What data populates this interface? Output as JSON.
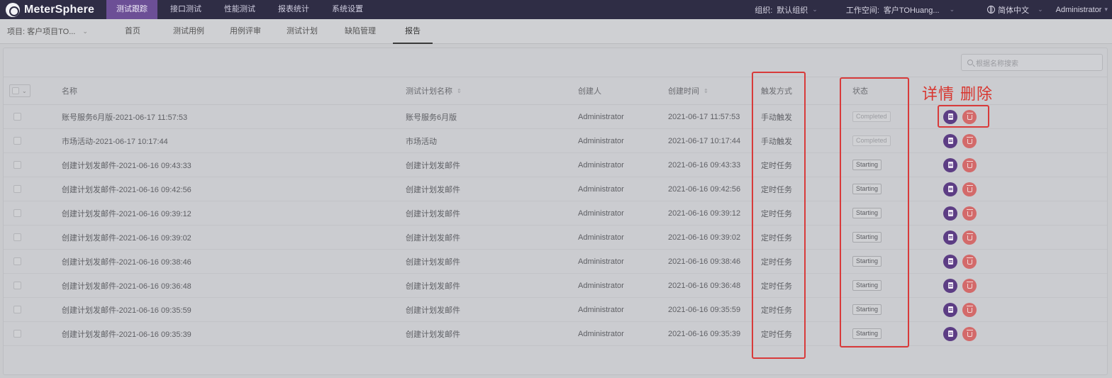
{
  "app": {
    "logo": "MeterSphere"
  },
  "topnav": {
    "items": [
      {
        "label": "测试跟踪"
      },
      {
        "label": "接口测试"
      },
      {
        "label": "性能测试"
      },
      {
        "label": "报表统计"
      },
      {
        "label": "系统设置"
      }
    ]
  },
  "topright": {
    "org_label": "组织:",
    "org_value": "默认组织",
    "workspace_label": "工作空间:",
    "workspace_value": "客户TOHuang...",
    "language": "简体中文",
    "user": "Administrator"
  },
  "subnav": {
    "project_label": "项目: 客户项目TO...",
    "items": [
      {
        "label": "首页"
      },
      {
        "label": "测试用例"
      },
      {
        "label": "用例评审"
      },
      {
        "label": "测试计划"
      },
      {
        "label": "缺陷管理"
      },
      {
        "label": "报告"
      }
    ]
  },
  "search": {
    "placeholder": "根据名称搜索"
  },
  "table": {
    "headers": {
      "name": "名称",
      "plan": "测试计划名称",
      "creator": "创建人",
      "created_time": "创建时间",
      "trigger": "触发方式",
      "status": "状态"
    },
    "rows": [
      {
        "name": "账号服务6月版-2021-06-17 11:57:53",
        "plan": "账号服务6月版",
        "creator": "Administrator",
        "time": "2021-06-17 11:57:53",
        "trigger": "手动触发",
        "status": "Completed"
      },
      {
        "name": "市场活动-2021-06-17 10:17:44",
        "plan": "市场活动",
        "creator": "Administrator",
        "time": "2021-06-17 10:17:44",
        "trigger": "手动触发",
        "status": "Completed"
      },
      {
        "name": "创建计划发邮件-2021-06-16 09:43:33",
        "plan": "创建计划发邮件",
        "creator": "Administrator",
        "time": "2021-06-16 09:43:33",
        "trigger": "定时任务",
        "status": "Starting"
      },
      {
        "name": "创建计划发邮件-2021-06-16 09:42:56",
        "plan": "创建计划发邮件",
        "creator": "Administrator",
        "time": "2021-06-16 09:42:56",
        "trigger": "定时任务",
        "status": "Starting"
      },
      {
        "name": "创建计划发邮件-2021-06-16 09:39:12",
        "plan": "创建计划发邮件",
        "creator": "Administrator",
        "time": "2021-06-16 09:39:12",
        "trigger": "定时任务",
        "status": "Starting"
      },
      {
        "name": "创建计划发邮件-2021-06-16 09:39:02",
        "plan": "创建计划发邮件",
        "creator": "Administrator",
        "time": "2021-06-16 09:39:02",
        "trigger": "定时任务",
        "status": "Starting"
      },
      {
        "name": "创建计划发邮件-2021-06-16 09:38:46",
        "plan": "创建计划发邮件",
        "creator": "Administrator",
        "time": "2021-06-16 09:38:46",
        "trigger": "定时任务",
        "status": "Starting"
      },
      {
        "name": "创建计划发邮件-2021-06-16 09:36:48",
        "plan": "创建计划发邮件",
        "creator": "Administrator",
        "time": "2021-06-16 09:36:48",
        "trigger": "定时任务",
        "status": "Starting"
      },
      {
        "name": "创建计划发邮件-2021-06-16 09:35:59",
        "plan": "创建计划发邮件",
        "creator": "Administrator",
        "time": "2021-06-16 09:35:59",
        "trigger": "定时任务",
        "status": "Starting"
      },
      {
        "name": "创建计划发邮件-2021-06-16 09:35:39",
        "plan": "创建计划发邮件",
        "creator": "Administrator",
        "time": "2021-06-16 09:35:39",
        "trigger": "定时任务",
        "status": "Starting"
      }
    ]
  },
  "annotation": {
    "text": "详情 删除",
    "color": "#d8362f"
  },
  "colors": {
    "topbar": "#2f2d45",
    "accent": "#6c4f96",
    "detail_button": "#5c3d84",
    "delete_button": "#d36a6a",
    "highlight": "#d83a3a"
  }
}
